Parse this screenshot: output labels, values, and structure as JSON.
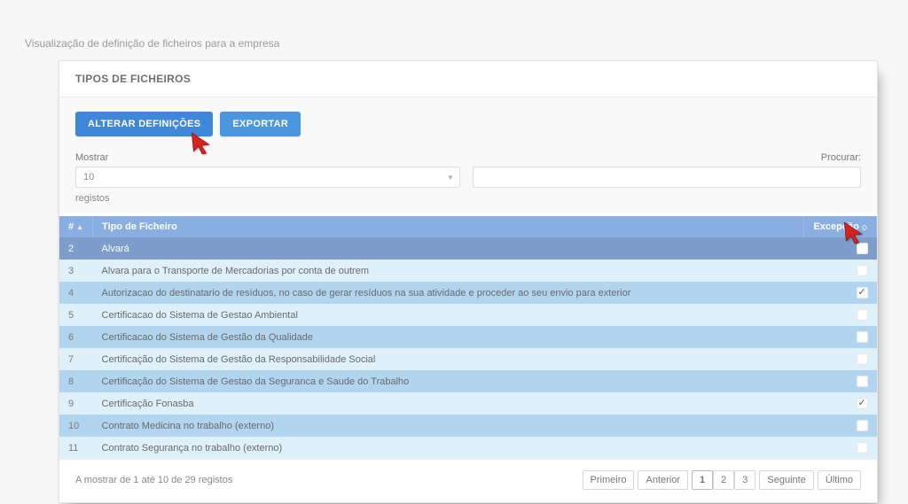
{
  "page": {
    "title": "Visualização de definição de ficheiros para a empresa"
  },
  "panel": {
    "title": "TIPOS DE FICHEIROS"
  },
  "buttons": {
    "alter": "ALTERAR DEFINIÇÕES",
    "export": "EXPORTAR"
  },
  "controls": {
    "show_label": "Mostrar",
    "show_value": "10",
    "registos": "registos",
    "search_label": "Procurar:",
    "search_value": ""
  },
  "table": {
    "headers": {
      "num": "#",
      "tipo": "Tipo de Ficheiro",
      "excecao": "Excepção"
    },
    "rows": [
      {
        "n": "2",
        "tipo": "Alvará",
        "checked": false,
        "cls": "selected"
      },
      {
        "n": "3",
        "tipo": "Alvara para o Transporte de Mercadorias por conta de outrem",
        "checked": false,
        "cls": "pale"
      },
      {
        "n": "4",
        "tipo": "Autorizacao do destinatario de resíduos, no caso de gerar resíduos na sua atividade e proceder ao seu envio para exterior",
        "checked": true,
        "cls": "dark"
      },
      {
        "n": "5",
        "tipo": "Certificacao do Sistema de Gestao Ambiental",
        "checked": false,
        "cls": "pale"
      },
      {
        "n": "6",
        "tipo": "Certificacao do Sistema de Gestão da Qualidade",
        "checked": false,
        "cls": "dark"
      },
      {
        "n": "7",
        "tipo": "Certificação do Sistema de Gestão da Responsabilidade Social",
        "checked": false,
        "cls": "pale"
      },
      {
        "n": "8",
        "tipo": "Certificação do Sistema de Gestao da Seguranca e Saude do Trabalho",
        "checked": false,
        "cls": "dark"
      },
      {
        "n": "9",
        "tipo": "Certificação Fonasba",
        "checked": true,
        "cls": "pale"
      },
      {
        "n": "10",
        "tipo": "Contrato Medicina no trabalho (externo)",
        "checked": false,
        "cls": "dark"
      },
      {
        "n": "11",
        "tipo": "Contrato Segurança no trabalho (externo)",
        "checked": false,
        "cls": "pale"
      }
    ]
  },
  "footer": {
    "info": "A mostrar de 1 até 10 de 29 registos",
    "pager": {
      "first": "Primeiro",
      "prev": "Anterior",
      "pages": [
        "1",
        "2",
        "3"
      ],
      "next": "Seguinte",
      "last": "Último",
      "active": "1"
    }
  }
}
